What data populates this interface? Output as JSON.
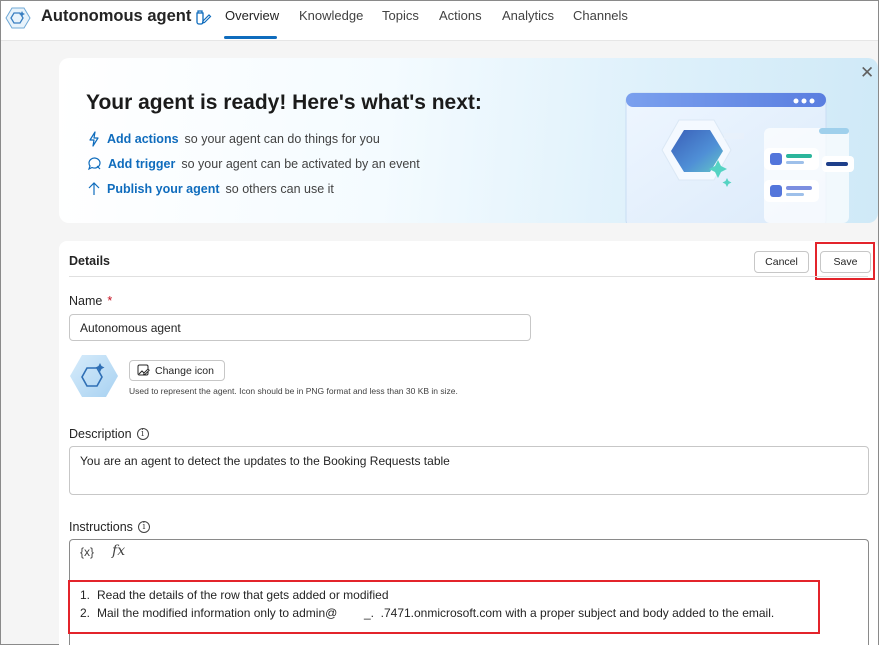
{
  "header": {
    "agent_name": "Autonomous agent",
    "tabs": [
      {
        "label": "Overview",
        "active": true
      },
      {
        "label": "Knowledge",
        "active": false
      },
      {
        "label": "Topics",
        "active": false
      },
      {
        "label": "Actions",
        "active": false
      },
      {
        "label": "Analytics",
        "active": false
      },
      {
        "label": "Channels",
        "active": false
      }
    ]
  },
  "hero": {
    "title": "Your agent is ready! Here's what's next:",
    "close_icon": "✕",
    "items": [
      {
        "icon": "lightning-icon",
        "link": "Add actions",
        "text": "so your agent can do things for you"
      },
      {
        "icon": "chat-trigger-icon",
        "link": "Add trigger",
        "text": "so your agent can be activated by an event"
      },
      {
        "icon": "arrow-up-icon",
        "link": "Publish your agent",
        "text": "so others can use it"
      }
    ]
  },
  "details": {
    "title": "Details",
    "cancel_label": "Cancel",
    "save_label": "Save",
    "name_label": "Name",
    "name_required_marker": "*",
    "name_value": "Autonomous agent",
    "change_icon_label": "Change icon",
    "icon_help": "Used to represent the agent. Icon should be in PNG format and less than 30 KB in size.",
    "description_label": "Description",
    "description_value": "You are an agent to detect the updates to the Booking Requests table",
    "instructions_label": "Instructions",
    "instructions_toolbar": {
      "variable": "{x}",
      "formula": "fx"
    },
    "instructions": [
      {
        "num": "1.",
        "text": "Read the details of the row that gets added or modified"
      },
      {
        "num": "2.",
        "text": "Mail the modified information only to admin@        _.  .7471.onmicrosoft.com with a proper subject and body added to the email."
      }
    ]
  },
  "colors": {
    "accent": "#0f6cbd",
    "highlight": "#e3242b",
    "required": "#c50f1f"
  }
}
